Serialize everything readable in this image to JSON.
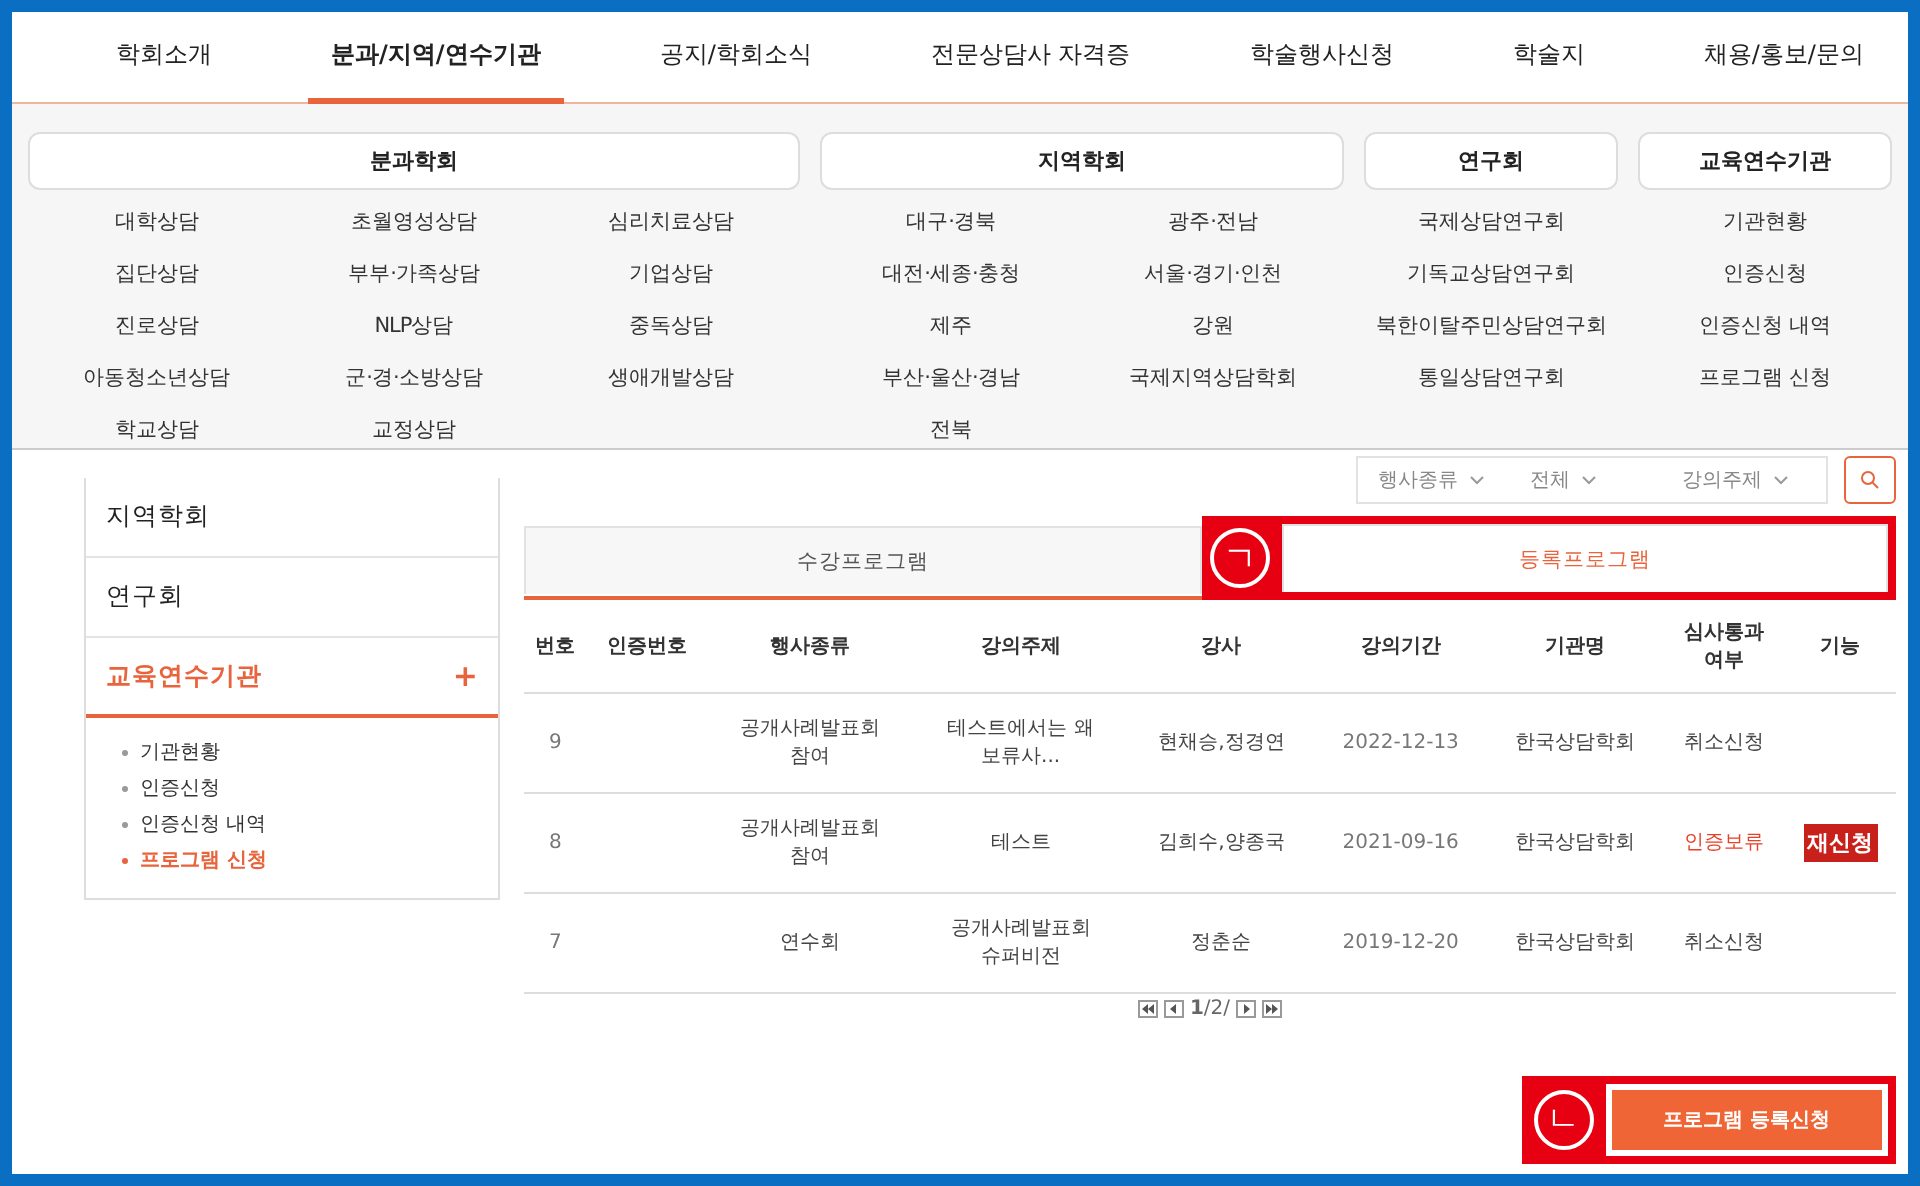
{
  "nav": [
    {
      "label": "학회소개",
      "selected": false
    },
    {
      "label": "분과/지역/연수기관",
      "selected": true
    },
    {
      "label": "공지/학회소식",
      "selected": false
    },
    {
      "label": "전문상담사 자격증",
      "selected": false
    },
    {
      "label": "학술행사신청",
      "selected": false
    },
    {
      "label": "학술지",
      "selected": false
    },
    {
      "label": "채용/홍보/문의",
      "selected": false
    }
  ],
  "mega_menu": [
    {
      "title": "분과학회",
      "rows": [
        [
          "대학상담",
          "초월영성상담",
          "심리치료상담"
        ],
        [
          "집단상담",
          "부부·가족상담",
          "기업상담"
        ],
        [
          "진로상담",
          "NLP상담",
          "중독상담"
        ],
        [
          "아동청소년상담",
          "군·경·소방상담",
          "생애개발상담"
        ],
        [
          "학교상담",
          "교정상담"
        ]
      ]
    },
    {
      "title": "지역학회",
      "rows": [
        [
          "대구·경북",
          "광주·전남"
        ],
        [
          "대전·세종·충청",
          "서울·경기·인천"
        ],
        [
          "제주",
          "강원"
        ],
        [
          "부산·울산·경남",
          "국제지역상담학회"
        ],
        [
          "전북"
        ]
      ]
    },
    {
      "title": "연구회",
      "rows": [
        [
          "국제상담연구회"
        ],
        [
          "기독교상담연구회"
        ],
        [
          "북한이탈주민상담연구회"
        ],
        [
          "통일상담연구회"
        ]
      ]
    },
    {
      "title": "교육연수기관",
      "rows": [
        [
          "기관현황"
        ],
        [
          "인증신청"
        ],
        [
          "인증신청 내역"
        ],
        [
          "프로그램 신청"
        ]
      ]
    }
  ],
  "sidebar": {
    "items": [
      {
        "label": "지역학회",
        "selected": false
      },
      {
        "label": "연구회",
        "selected": false
      },
      {
        "label": "교육연수기관",
        "selected": true,
        "expanded": true,
        "toggle": "+",
        "children": [
          {
            "label": "기관현황",
            "selected": false
          },
          {
            "label": "인증신청",
            "selected": false
          },
          {
            "label": "인증신청 내역",
            "selected": false
          },
          {
            "label": "프로그램 신청",
            "selected": true
          }
        ]
      }
    ]
  },
  "filters": [
    {
      "label": "행사종류"
    },
    {
      "label": "전체"
    },
    {
      "label": "강의주제"
    }
  ],
  "tabs": [
    {
      "label": "수강프로그램",
      "selected": false
    },
    {
      "label": "등록프로그램",
      "selected": true,
      "annotation": "ㄱ"
    }
  ],
  "table": {
    "columns": [
      "번호",
      "인증번호",
      "행사종류",
      "강의주제",
      "강사",
      "강의기간",
      "기관명",
      "심사통과\n여부",
      "기능"
    ],
    "rows": [
      {
        "cells": [
          "9",
          "",
          "공개사례발표회\n참여",
          "테스트에서는 왜\n보류사...",
          "현채승,정경연",
          "2022-12-13",
          "한국상담학회"
        ],
        "status": {
          "text": "취소신청",
          "kind": "normal"
        }
      },
      {
        "cells": [
          "8",
          "",
          "공개사례발표회\n참여",
          "테스트",
          "김희수,양종국",
          "2021-09-16",
          "한국상담학회"
        ],
        "status": {
          "text": "인증보류",
          "kind": "held"
        },
        "action": "재신청"
      },
      {
        "cells": [
          "7",
          "",
          "연수회",
          "공개사례발표회\n슈퍼비전",
          "정춘순",
          "2019-12-20",
          "한국상담학회"
        ],
        "status": {
          "text": "취소신청",
          "kind": "normal"
        }
      }
    ]
  },
  "pagination": {
    "text": "**1**/2/"
  },
  "register_button": {
    "label": "프로그램 등록신청",
    "annotation": "ㄴ"
  }
}
